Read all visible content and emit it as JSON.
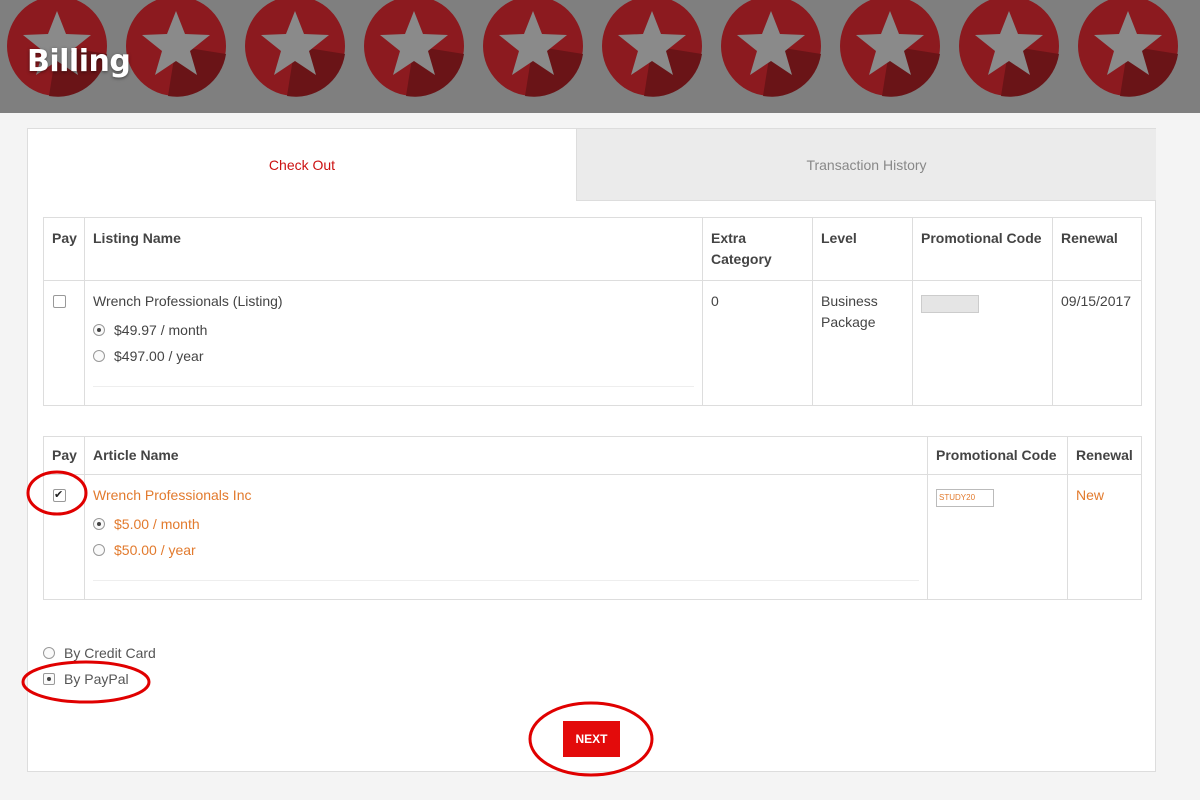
{
  "page": {
    "title": "Billing"
  },
  "tabs": [
    {
      "label": "Check Out",
      "active": true
    },
    {
      "label": "Transaction History",
      "active": false
    }
  ],
  "listings_table": {
    "headers": {
      "pay": "Pay",
      "name": "Listing Name",
      "extra": "Extra Category",
      "level": "Level",
      "promo": "Promotional Code",
      "renewal": "Renewal"
    },
    "row": {
      "pay_checked": false,
      "name": "Wrench Professionals (Listing)",
      "options": [
        {
          "label": "$49.97 / month",
          "selected": true
        },
        {
          "label": "$497.00 / year",
          "selected": false
        }
      ],
      "extra_category": "0",
      "level": "Business Package",
      "promo_value": "",
      "renewal": "09/15/2017"
    }
  },
  "articles_table": {
    "headers": {
      "pay": "Pay",
      "name": "Article Name",
      "promo": "Promotional Code",
      "renewal": "Renewal"
    },
    "row": {
      "pay_checked": true,
      "name": "Wrench Professionals Inc",
      "options": [
        {
          "label": "$5.00 / month",
          "selected": true
        },
        {
          "label": "$50.00 / year",
          "selected": false
        }
      ],
      "promo_value": "STUDY20",
      "renewal": "New"
    }
  },
  "payment_methods": [
    {
      "label": "By Credit Card",
      "selected": false
    },
    {
      "label": "By PayPal",
      "selected": true
    }
  ],
  "next_button": {
    "label": "NEXT"
  },
  "colors": {
    "accent_red": "#e30b0b",
    "orange_text": "#e27a2d",
    "header_gray": "#7f7f7f",
    "annotation_red": "#e00000"
  },
  "icons": {
    "header_background": "star-badge-icon"
  }
}
